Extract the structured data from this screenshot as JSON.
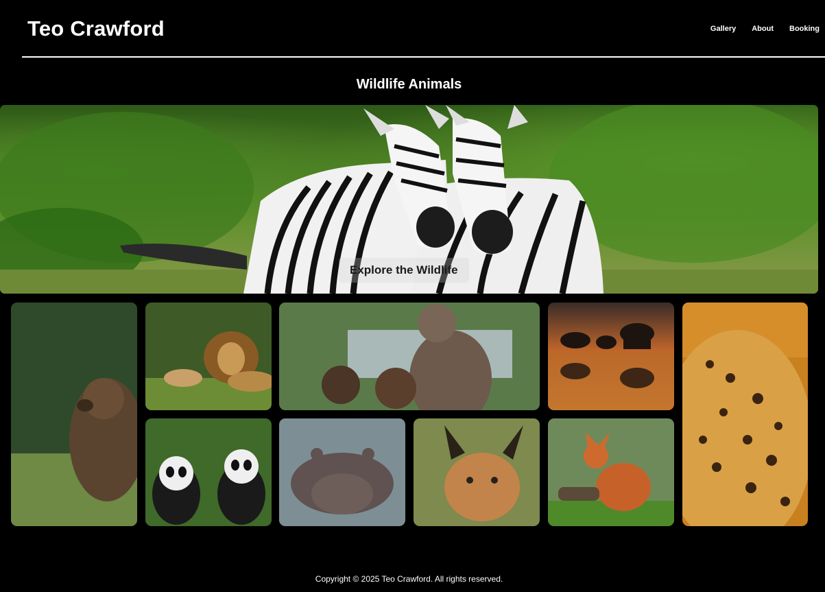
{
  "header": {
    "brand": "Teo Crawford",
    "nav": [
      {
        "label": "Gallery"
      },
      {
        "label": "About"
      },
      {
        "label": "Booking"
      }
    ]
  },
  "section": {
    "title": "Wildlife Animals"
  },
  "hero": {
    "cta_label": "Explore the Wildlife",
    "image_subject": "two zebras"
  },
  "gallery": {
    "images": [
      {
        "subject": "brown bear"
      },
      {
        "subject": "lions"
      },
      {
        "subject": "bear cubs"
      },
      {
        "subject": "elephants at sunset"
      },
      {
        "subject": "leopard"
      },
      {
        "subject": "pandas"
      },
      {
        "subject": "hippo"
      },
      {
        "subject": "caracal"
      },
      {
        "subject": "red fox"
      }
    ]
  },
  "footer": {
    "copyright": "Copyright © 2025 Teo Crawford. All rights reserved."
  }
}
